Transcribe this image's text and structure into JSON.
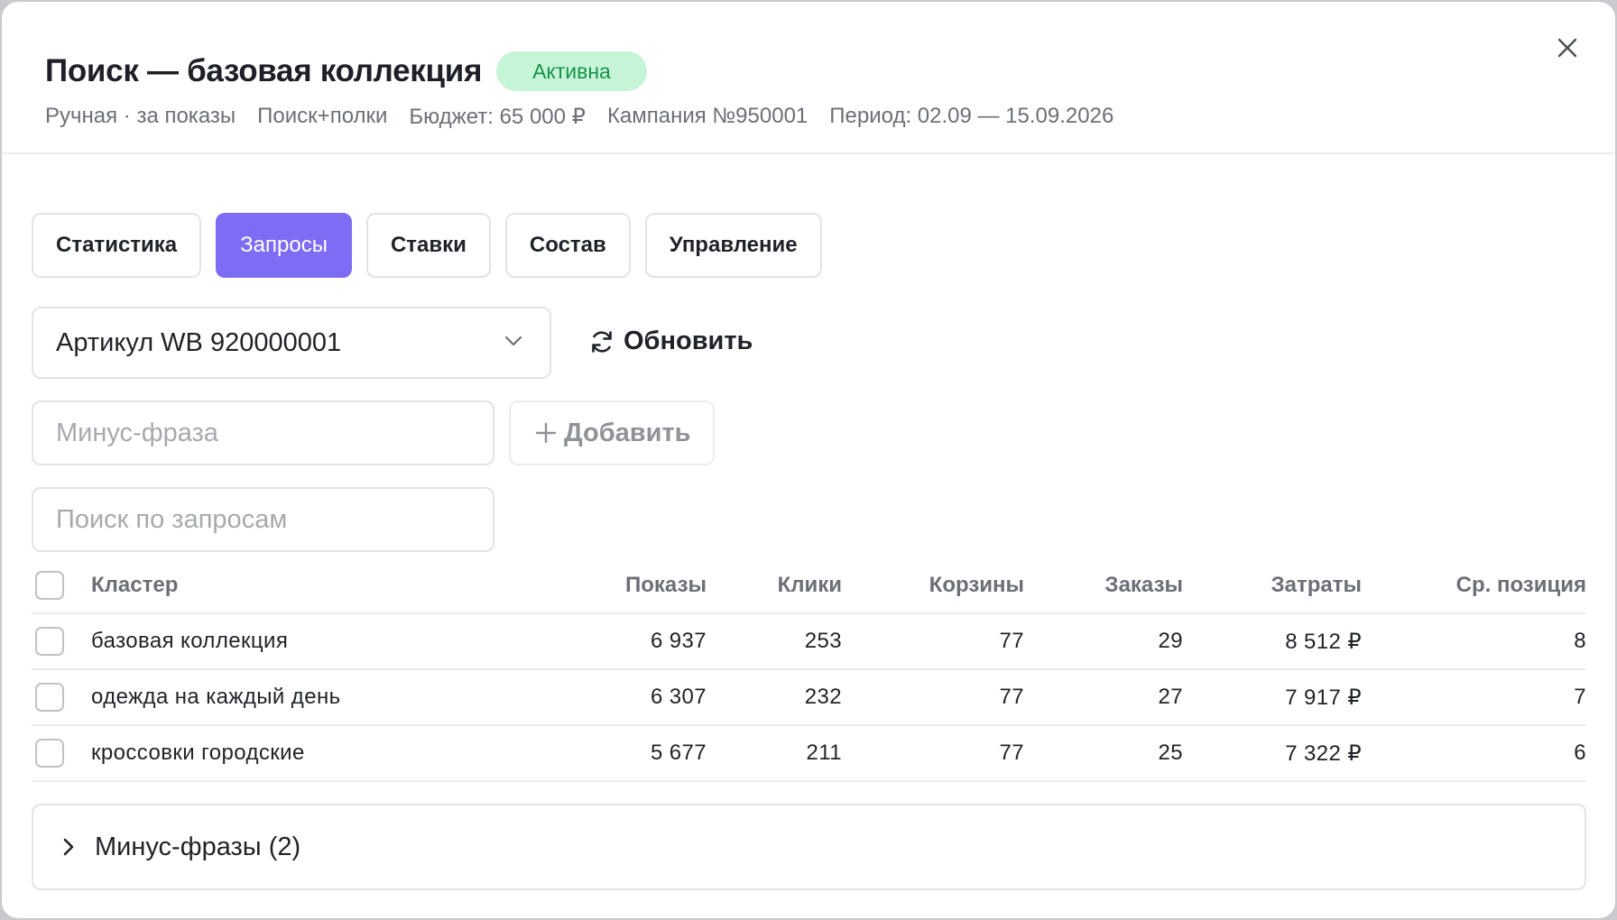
{
  "header": {
    "title": "Поиск — базовая коллекция",
    "status_badge": "Активна",
    "meta": [
      "Ручная · за показы",
      "Поиск+полки",
      "Бюджет: 65 000 ₽",
      "Кампания №950001",
      "Период: 02.09 — 15.09.2026"
    ],
    "close_icon": "close-icon"
  },
  "tabs": [
    {
      "label": "Статистика",
      "active": false
    },
    {
      "label": "Запросы",
      "active": true
    },
    {
      "label": "Ставки",
      "active": false
    },
    {
      "label": "Состав",
      "active": false
    },
    {
      "label": "Управление",
      "active": false
    }
  ],
  "article_select": {
    "value": "Артикул WB 920000001",
    "icon": "chevron-down-icon"
  },
  "refresh": {
    "label": "Обновить",
    "icon": "refresh-icon"
  },
  "minus_phrase": {
    "placeholder": "Минус-фраза",
    "value": ""
  },
  "add_button": {
    "label": "Добавить",
    "icon": "plus-icon"
  },
  "search": {
    "placeholder": "Поиск по запросам",
    "value": ""
  },
  "table": {
    "columns": [
      "Кластер",
      "Показы",
      "Клики",
      "Корзины",
      "Заказы",
      "Затраты",
      "Ср. позиция"
    ],
    "rows": [
      [
        "базовая коллекция",
        "6 937",
        "253",
        "77",
        "29",
        "8 512 ₽",
        "8"
      ],
      [
        "одежда на каждый день",
        "6 307",
        "232",
        "77",
        "27",
        "7 917 ₽",
        "7"
      ],
      [
        "кроссовки городские",
        "5 677",
        "211",
        "77",
        "25",
        "7 322 ₽",
        "6"
      ]
    ]
  },
  "minus_phrases_section": {
    "label": "Минус-фразы (2)",
    "icon": "chevron-right-icon"
  },
  "colors": {
    "accent": "#7e6cf4",
    "badge_bg": "#c6f4d6",
    "badge_text": "#17924a"
  }
}
